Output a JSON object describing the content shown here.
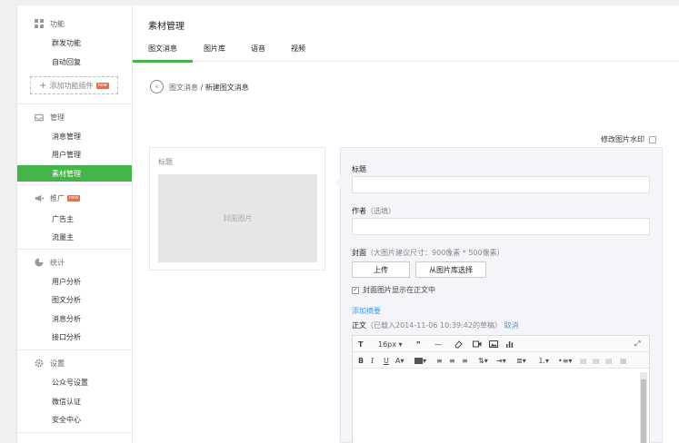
{
  "sidebar": {
    "sections": [
      {
        "title": "功能",
        "icon": "grid-icon",
        "items": [
          "群发功能",
          "自动回复"
        ]
      },
      {
        "title": "管理",
        "icon": "inbox-icon",
        "items": [
          "消息管理",
          "用户管理",
          "素材管理"
        ]
      },
      {
        "title": "推广",
        "icon": "megaphone-icon",
        "badge": "new",
        "items": [
          "广告主",
          "流量主"
        ]
      },
      {
        "title": "统计",
        "icon": "pie-chart-icon",
        "items": [
          "用户分析",
          "图文分析",
          "消息分析",
          "接口分析"
        ]
      },
      {
        "title": "设置",
        "icon": "gear-icon",
        "items": [
          "公众号设置",
          "微信认证",
          "安全中心"
        ]
      }
    ],
    "add_plugin": "添加功能插件",
    "add_plugin_badge": "new",
    "active_item": "素材管理"
  },
  "header": {
    "title": "素材管理"
  },
  "tabs": [
    {
      "label": "图文消息",
      "active": true
    },
    {
      "label": "图片库"
    },
    {
      "label": "语音"
    },
    {
      "label": "视频"
    }
  ],
  "breadcrumb": {
    "first": "图文消息",
    "sep": " / ",
    "current": "新建图文消息"
  },
  "watermark": {
    "label": "修改图片水印"
  },
  "preview": {
    "title": "标题",
    "cover": "封面图片"
  },
  "form": {
    "title_label": "标题",
    "author_label": "作者",
    "author_hint": "（选填）",
    "cover_label": "封面",
    "cover_hint": "（大图片建议尺寸：900像素 * 500像素）",
    "upload_btn": "上传",
    "library_btn": "从图片库选择",
    "show_cover_label": "封面图片显示在正文中",
    "show_cover_checked": true,
    "add_summary": "添加摘要",
    "body_label": "正文",
    "body_hint": "（已载入2014-11-06 10:39:42的草稿）",
    "cancel": "取消"
  },
  "editor": {
    "font_size": "16px",
    "toolbar1": [
      "text-format-icon",
      "font-size-select",
      "quote-icon",
      "horizontal-rule-icon",
      "eraser-icon",
      "video-icon",
      "image-icon",
      "chart-icon",
      "fullscreen-icon"
    ],
    "toolbar2": [
      "bold-icon",
      "italic-icon",
      "underline-icon",
      "font-color-icon",
      "background-color-icon",
      "align-left-icon",
      "align-center-icon",
      "align-right-icon",
      "paragraph-spacing-icon",
      "indent-icon",
      "line-height-icon",
      "ordered-list-icon",
      "unordered-list-icon",
      "image-float-left-icon",
      "image-float-center-icon",
      "image-float-right-icon",
      "clear-float-icon"
    ]
  },
  "colors": {
    "accent": "#44b549",
    "link": "#459ae9",
    "badge": "#f06c3a"
  }
}
